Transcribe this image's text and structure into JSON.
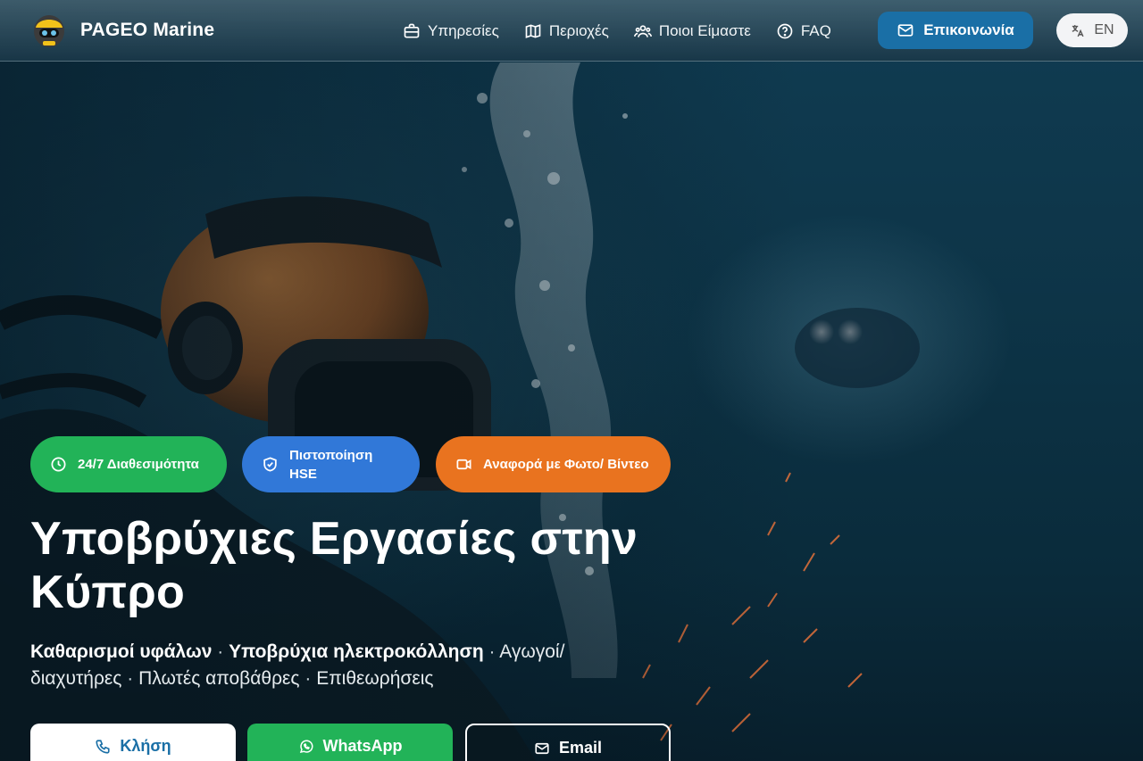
{
  "brand": {
    "name": "PAGEO Marine",
    "logo_icon": "diver-helmet-icon"
  },
  "nav": {
    "items": [
      {
        "label": "Υπηρεσίες",
        "icon": "briefcase-icon"
      },
      {
        "label": "Περιοχές",
        "icon": "map-icon"
      },
      {
        "label": "Ποιοι Είμαστε",
        "icon": "users-icon"
      },
      {
        "label": "FAQ",
        "icon": "help-circle-icon"
      }
    ],
    "contact_label": "Επικοινωνία",
    "language_label": "EN"
  },
  "badges": [
    {
      "label": "24/7 Διαθεσιμότητα",
      "icon": "clock-icon",
      "color": "#22b358"
    },
    {
      "label": "Πιστοποίηση HSE",
      "icon": "shield-check-icon",
      "color": "#3178d8"
    },
    {
      "label": "Αναφορά με Φωτο/ Βίντεο",
      "icon": "video-icon",
      "color": "#e9731f"
    }
  ],
  "hero": {
    "title": "Υποβρύχιες Εργασίες στην Κύπρο",
    "services": [
      {
        "text": "Καθαρισμοί υφάλων",
        "emphasis": true
      },
      {
        "text": "Υποβρύχια ηλεκτροκόλληση",
        "emphasis": true
      },
      {
        "text": "Αγωγοί/ διαχυτήρες",
        "emphasis": false
      },
      {
        "text": "Πλωτές αποβάθρες",
        "emphasis": false
      },
      {
        "text": "Επιθεωρήσεις",
        "emphasis": false
      }
    ],
    "separator": "·"
  },
  "cta": {
    "call_label": "Κλήση",
    "whatsapp_label": "WhatsApp",
    "email_label": "Email"
  },
  "colors": {
    "primary": "#1a6fa6",
    "green": "#22b358",
    "blue": "#3178d8",
    "orange": "#e9731f"
  }
}
